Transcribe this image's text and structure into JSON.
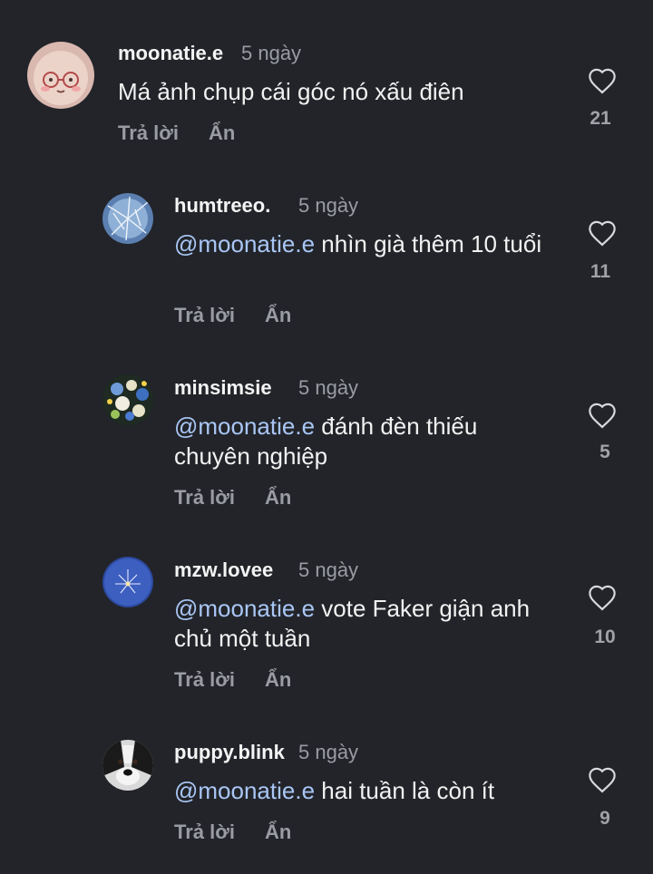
{
  "comments": [
    {
      "username": "moonatie.e",
      "time": "5 ngày",
      "text": "Má ảnh chụp cái góc nó xấu điên",
      "reply_label": "Trả lời",
      "hide_label": "Ẩn",
      "likes": "21"
    },
    {
      "username": "humtreeo.",
      "time": "5 ngày",
      "mention": "@moonatie.e",
      "text": " nhìn già thêm 10 tuổi",
      "reply_label": "Trả lời",
      "hide_label": "Ẩn",
      "likes": "11"
    },
    {
      "username": "minsimsie",
      "time": "5 ngày",
      "mention": "@moonatie.e",
      "text": " đánh đèn thiếu chuyên nghiệp",
      "reply_label": "Trả lời",
      "hide_label": "Ẩn",
      "likes": "5"
    },
    {
      "username": "mzw.lovee",
      "time": "5 ngày",
      "mention": "@moonatie.e",
      "text": " vote Faker giận anh chủ một tuần",
      "reply_label": "Trả lời",
      "hide_label": "Ẩn",
      "likes": "10"
    },
    {
      "username": "puppy.blink",
      "time": "5 ngày",
      "mention": "@moonatie.e",
      "text": " hai tuần là còn ít",
      "reply_label": "Trả lời",
      "hide_label": "Ẩn",
      "likes": "9"
    }
  ],
  "icons": {
    "like": "heart-outline-icon"
  },
  "colors": {
    "background": "#222429",
    "mention": "#a9c6f5",
    "secondary_text": "#9a9ca3"
  }
}
